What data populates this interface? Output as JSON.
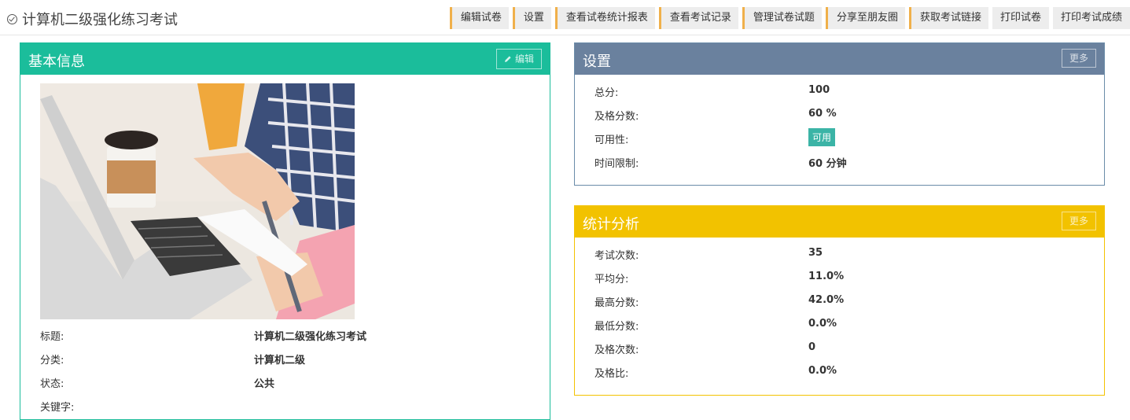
{
  "header": {
    "title": "计算机二级强化练习考试"
  },
  "toolbar": [
    {
      "label": "编辑试卷",
      "accent": true
    },
    {
      "label": "设置",
      "accent": true
    },
    {
      "label": "查看试卷统计报表",
      "accent": true
    },
    {
      "label": "查看考试记录",
      "accent": true
    },
    {
      "label": "管理试卷试题",
      "accent": true
    },
    {
      "label": "分享至朋友圈",
      "accent": true
    },
    {
      "label": "获取考试链接",
      "accent": true
    },
    {
      "label": "打印试卷",
      "accent": false
    },
    {
      "label": "打印考试成绩",
      "accent": false
    }
  ],
  "basic": {
    "title": "基本信息",
    "edit_label": "编辑",
    "image_description_icon": "laptop-meeting-photo",
    "fields": [
      {
        "key": "标题:",
        "value": "计算机二级强化练习考试"
      },
      {
        "key": "分类:",
        "value": "计算机二级"
      },
      {
        "key": "状态:",
        "value": "公共"
      },
      {
        "key": "关键字:",
        "value": ""
      }
    ]
  },
  "settings": {
    "title": "设置",
    "more_label": "更多",
    "fields": [
      {
        "key": "总分:",
        "value": "100"
      },
      {
        "key": "及格分数:",
        "value": "60 %"
      },
      {
        "key": "可用性:",
        "value": "可用",
        "badge": true
      },
      {
        "key": "时间限制:",
        "value": "60 分钟"
      }
    ]
  },
  "stats": {
    "title": "统计分析",
    "more_label": "更多",
    "fields": [
      {
        "key": "考试次数:",
        "value": "35"
      },
      {
        "key": "平均分:",
        "value": "11.0%"
      },
      {
        "key": "最高分数:",
        "value": "42.0%"
      },
      {
        "key": "最低分数:",
        "value": "0.0%"
      },
      {
        "key": "及格次数:",
        "value": "0"
      },
      {
        "key": "及格比:",
        "value": "0.0%"
      }
    ]
  },
  "colors": {
    "basic_header": "#1bbd9b",
    "settings_header": "#6a819e",
    "stats_header": "#f2c200",
    "toolbar_accent": "#f0b04a",
    "badge": "#3bb4a6"
  }
}
